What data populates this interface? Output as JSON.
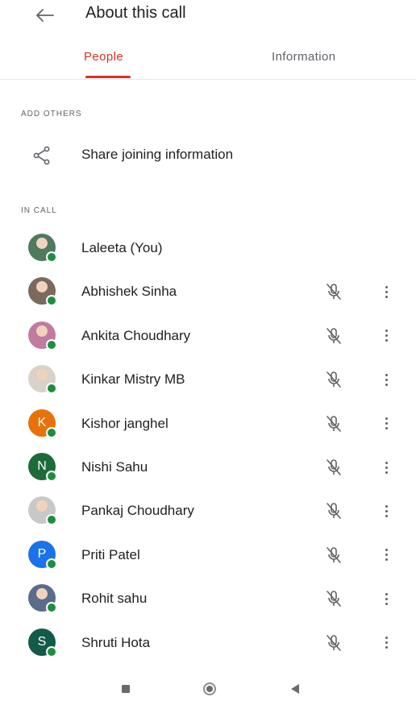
{
  "header": {
    "title": "About this call",
    "back_icon": "arrow-left-icon"
  },
  "tabs": [
    {
      "label": "People",
      "active": true
    },
    {
      "label": "Information",
      "active": false
    }
  ],
  "accent_color": "#d93025",
  "presence_color": "#1e8e3e",
  "add_others": {
    "section_label": "ADD OTHERS",
    "share_label": "Share joining information",
    "share_icon": "share-icon"
  },
  "in_call": {
    "section_label": "IN CALL",
    "participants": [
      {
        "name": "Laleeta (You)",
        "avatar_type": "photo",
        "avatar_initial": "",
        "avatar_color": "#4e7a5e",
        "muted": false
      },
      {
        "name": "Abhishek Sinha",
        "avatar_type": "photo",
        "avatar_initial": "",
        "avatar_color": "#7b6a5c",
        "muted": true
      },
      {
        "name": "Ankita Choudhary",
        "avatar_type": "photo",
        "avatar_initial": "",
        "avatar_color": "#c27aa0",
        "muted": true
      },
      {
        "name": "Kinkar Mistry MB",
        "avatar_type": "photo",
        "avatar_initial": "",
        "avatar_color": "#d9d2c8",
        "muted": true
      },
      {
        "name": "Kishor janghel",
        "avatar_type": "initial",
        "avatar_initial": "K",
        "avatar_color": "#e8710a",
        "muted": true
      },
      {
        "name": "Nishi Sahu",
        "avatar_type": "initial",
        "avatar_initial": "N",
        "avatar_color": "#1e6b3a",
        "muted": true
      },
      {
        "name": "Pankaj Choudhary",
        "avatar_type": "photo",
        "avatar_initial": "",
        "avatar_color": "#c8c8c8",
        "muted": true
      },
      {
        "name": "Priti Patel",
        "avatar_type": "initial",
        "avatar_initial": "P",
        "avatar_color": "#1a73e8",
        "muted": true
      },
      {
        "name": "Rohit sahu",
        "avatar_type": "photo",
        "avatar_initial": "",
        "avatar_color": "#5a6b8c",
        "muted": true
      },
      {
        "name": "Shruti Hota",
        "avatar_type": "initial",
        "avatar_initial": "S",
        "avatar_color": "#145a4a",
        "muted": true
      }
    ]
  },
  "navigation_bar": {
    "recent_icon": "square-icon",
    "home_icon": "circle-icon",
    "back_icon": "triangle-back-icon"
  }
}
